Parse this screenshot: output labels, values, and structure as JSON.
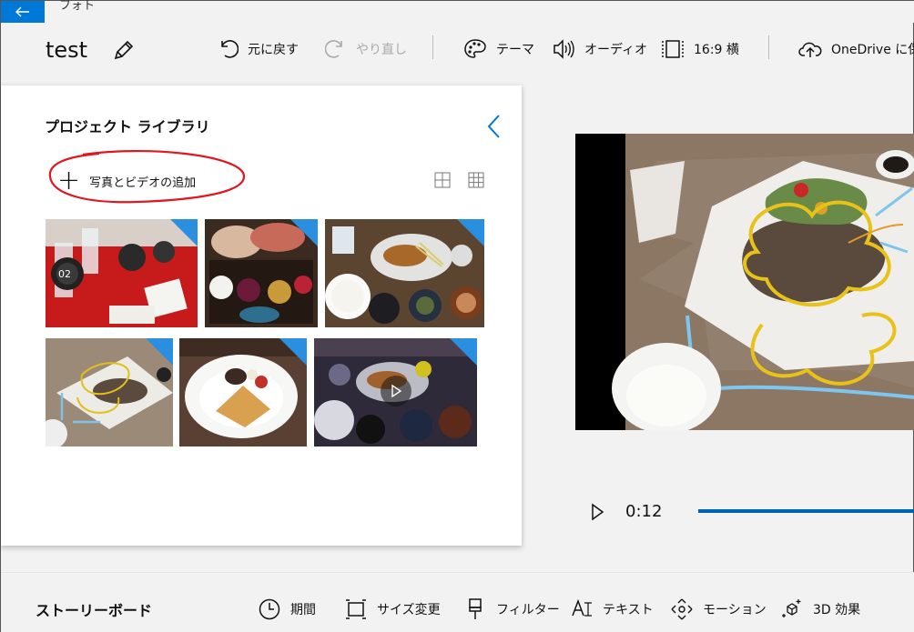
{
  "app": {
    "title": "フォト"
  },
  "project": {
    "name": "test"
  },
  "toolbar": {
    "undo": "元に戻す",
    "redo": "やり直し",
    "theme": "テーマ",
    "audio": "オーディオ",
    "aspect": "16:9 横",
    "onedrive": "OneDrive に保"
  },
  "library": {
    "title": "プロジェクト ライブラリ",
    "add_label": "写真とビデオの追加",
    "items": [
      {
        "kind": "photo",
        "subject": "watches on red table"
      },
      {
        "kind": "photo",
        "subject": "sashimi set meal"
      },
      {
        "kind": "photo",
        "subject": "katsu set meal"
      },
      {
        "kind": "photo",
        "subject": "steak with drawings"
      },
      {
        "kind": "photo",
        "subject": "dessert plate"
      },
      {
        "kind": "video",
        "subject": "set meal video"
      }
    ]
  },
  "player": {
    "time": "0:12",
    "progress": 1.0
  },
  "storyboard": {
    "title": "ストーリーボード",
    "tools": [
      "期間",
      "サイズ変更",
      "フィルター",
      "テキスト",
      "モーション",
      "3D 効果"
    ]
  },
  "colors": {
    "accent": "#0078d7",
    "annotation": "#e0171e",
    "used_badge": "#2b8fe0"
  },
  "icons": [
    "back-arrow-icon",
    "pencil-icon",
    "undo-icon",
    "redo-icon",
    "palette-icon",
    "speaker-icon",
    "aspect-ratio-icon",
    "cloud-upload-icon",
    "chevron-left-icon",
    "plus-icon",
    "large-grid-icon",
    "small-grid-icon",
    "play-icon",
    "clock-icon",
    "resize-icon",
    "brush-icon",
    "text-icon",
    "motion-icon",
    "sparkle-3d-icon"
  ]
}
